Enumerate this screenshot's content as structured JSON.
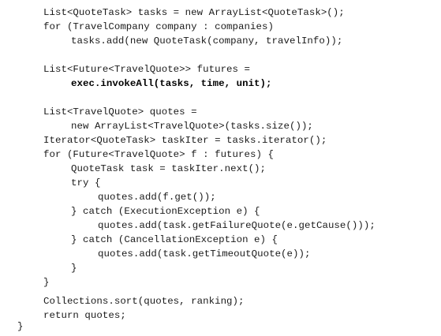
{
  "code": {
    "lines": [
      {
        "text": "List<QuoteTask> tasks = new ArrayList<QuoteTask>();",
        "bold": false
      },
      {
        "text": "for (TravelCompany company : companies)",
        "bold": false
      },
      {
        "text": "tasks.add(new QuoteTask(company, travelInfo));",
        "bold": false
      },
      {
        "text": "",
        "bold": false
      },
      {
        "text": "List<Future<TravelQuote>> futures =",
        "bold": false
      },
      {
        "text": "exec.invokeAll(tasks, time, unit);",
        "bold": true
      },
      {
        "text": "",
        "bold": false
      },
      {
        "text": "List<TravelQuote> quotes =",
        "bold": false
      },
      {
        "text": "new ArrayList<TravelQuote>(tasks.size());",
        "bold": false
      },
      {
        "text": "Iterator<QuoteTask> taskIter = tasks.iterator();",
        "bold": false
      },
      {
        "text": "for (Future<TravelQuote> f : futures) {",
        "bold": false
      },
      {
        "text": "QuoteTask task = taskIter.next();",
        "bold": false
      },
      {
        "text": "try {",
        "bold": false
      },
      {
        "text": "quotes.add(f.get());",
        "bold": false
      },
      {
        "text": "} catch (ExecutionException e) {",
        "bold": false
      },
      {
        "text": "quotes.add(task.getFailureQuote(e.getCause()));",
        "bold": false
      },
      {
        "text": "} catch (CancellationException e) {",
        "bold": false
      },
      {
        "text": "quotes.add(task.getTimeoutQuote(e));",
        "bold": false
      },
      {
        "text": "}",
        "bold": false
      },
      {
        "text": "}",
        "bold": false
      },
      {
        "text": "",
        "bold": false
      },
      {
        "text": "Collections.sort(quotes, ranking);",
        "bold": false
      },
      {
        "text": "return quotes;",
        "bold": false
      },
      {
        "text": "}",
        "bold": false
      }
    ]
  }
}
